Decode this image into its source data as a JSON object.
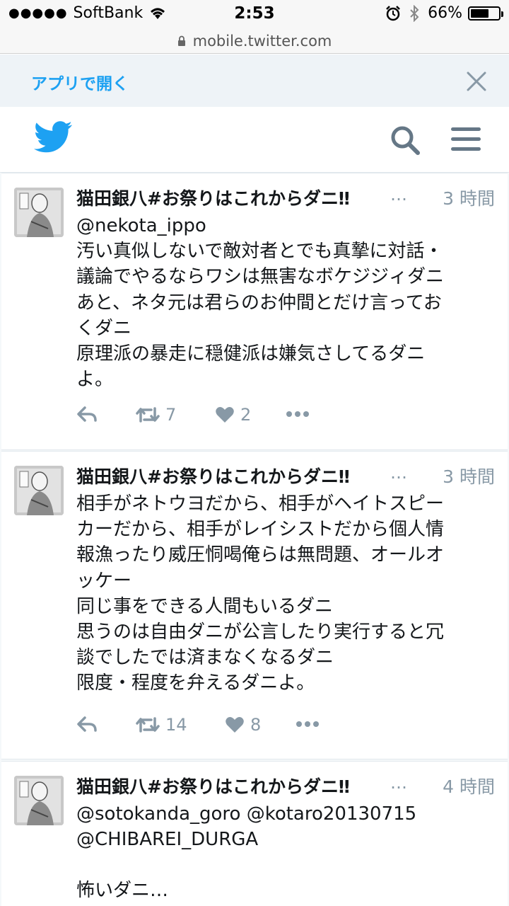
{
  "status_bar": {
    "carrier": "SoftBank",
    "time": "2:53",
    "battery": "66%",
    "battery_level": 0.66
  },
  "url_bar": {
    "url": "mobile.twitter.com"
  },
  "app_banner": {
    "label": "アプリで開く"
  },
  "tweets": [
    {
      "name": "猫田銀八#お祭りはこれからダニ‼",
      "ellipsis": "…",
      "time": "3 時間",
      "lines": [
        "@nekota_ippo",
        "汚い真似しないで敵対者とでも真摯に対話・",
        "議論でやるならワシは無害なボケジジィダニ",
        "あと、ネタ元は君らのお仲間とだけ言ってお",
        "くダニ",
        "原理派の暴走に穏健派は嫌気さしてるダニ",
        "よ。"
      ],
      "retweets": "7",
      "likes": "2"
    },
    {
      "name": "猫田銀八#お祭りはこれからダニ‼",
      "ellipsis": "…",
      "time": "3 時間",
      "lines": [
        "相手がネトウヨだから、相手がヘイトスピー",
        "カーだから、相手がレイシストだから個人情",
        "報漁ったり威圧恫喝俺らは無問題、オールオ",
        "ッケー",
        "同じ事をできる人間もいるダニ",
        "思うのは自由ダニが公言したり実行すると冗",
        "談でしたでは済まなくなるダニ",
        "限度・程度を弁えるダニよ。"
      ],
      "retweets": "14",
      "likes": "8"
    },
    {
      "name": "猫田銀八#お祭りはこれからダニ‼",
      "ellipsis": "…",
      "time": "4 時間",
      "lines": [
        "@sotokanda_goro @kotaro20130715",
        "@CHIBAREI_DURGA",
        "",
        "怖いダニ…"
      ]
    }
  ]
}
